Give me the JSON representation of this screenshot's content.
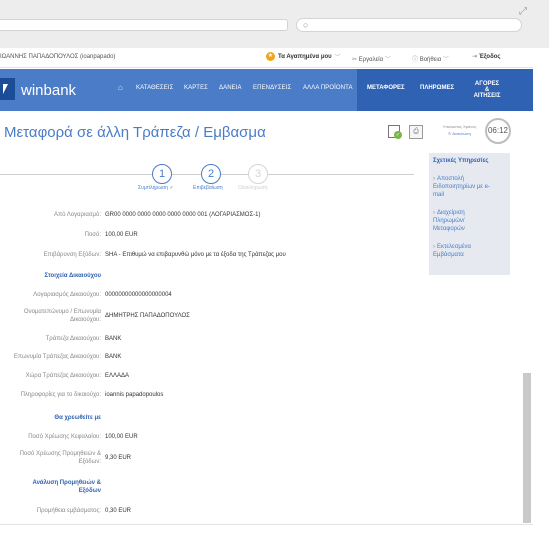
{
  "browser": {
    "search_icon": "search-icon",
    "expand_icon": "expand-icon"
  },
  "userbar": {
    "user": "ΙΩΑΝΝΗΣ ΠΑΠΑΔΟΠΟΥΛΟΣ (ioanpapado)",
    "favorites": "Τα Αγαπημένα μου",
    "tools": "Εργαλεία",
    "help": "Βοήθεια",
    "exit": "Έξοδος"
  },
  "nav": {
    "logo": "winbank",
    "items": [
      "ΚΑΤΑΘΕΣΕΙΣ",
      "ΚΑΡΤΕΣ",
      "ΔΑΝΕΙΑ",
      "ΕΠΕΝΔΥΣΕΙΣ",
      "ΑΛΛΑ ΠΡΟΪΟΝΤΑ"
    ],
    "right_items": [
      "ΜΕΤΑΦΟΡΕΣ",
      "ΠΛΗΡΩΜΕΣ",
      "ΑΓΟΡΕΣ",
      "& ΑΙΤΗΣΕΙΣ"
    ],
    "accent": "#4a7cc7",
    "active": "#2f62b3"
  },
  "page": {
    "title": "Μεταφορά σε άλλη Τράπεζα / Εμβασμα"
  },
  "steps": [
    {
      "num": "1",
      "label": "Συμπλήρωση ✓"
    },
    {
      "num": "2",
      "label": "Επιβεβαίωση"
    },
    {
      "num": "3",
      "label": "Ολοκλήρωση"
    }
  ],
  "form": {
    "from_account_label": "Από Λογαριασμό:",
    "from_account_value": "GR00 0000 0000 0000 0000 0000 001 (ΛΟΓΑΡΙΑΣΜΟΣ-1)",
    "amount_label": "Ποσό:",
    "amount_value": "100,00 EUR",
    "charges_label": "Επιβάρυνση Εξόδων:",
    "charges_value": "SHA - Επιθυμώ να επιβαρυνθώ μόνο με τα έξοδα της Τράπεζας μου",
    "beneficiary_section": "Στοιχεία Δικαιούχου",
    "ben_account_label": "Λογαριασμός Δικαιούχου:",
    "ben_account_value": "00000000000000000004",
    "ben_name_label_1": "Ονοματεπώνυμο / Επωνυμία",
    "ben_name_label_2": "Δικαιούχου:",
    "ben_name_value": "ΔΗΜΗΤΡΗΣ ΠΑΠΑΔΟΠΟΥΛΟΣ",
    "ben_bank_label": "Τράπεζα Δικαιούχου:",
    "ben_bank_value": "BANK",
    "ben_bank_name_label": "Επωνυμία Τράπεζας Δικαιούχου:",
    "ben_bank_name_value": "BANK",
    "ben_country_label": "Χώρα Τράπεζας Δικαιούχου:",
    "ben_country_value": "ΕΛΛΑΔΑ",
    "ben_info_label": "Πληροφορίες για το δικαιούχο:",
    "ben_info_value": "ioannis papadopoulos",
    "debit_section": "Θα χρεωθείτε με",
    "debit_principal_label": "Ποσό Χρέωσης Κεφαλαίου:",
    "debit_principal_value": "100,00 EUR",
    "debit_fees_label_1": "Ποσό Χρέωσης Προμηθειών &",
    "debit_fees_label_2": "Εξόδων:",
    "debit_fees_value": "9,30 EUR",
    "analysis_section_1": "Ανάλυση Προμηθειών &",
    "analysis_section_2": "Εξόδων",
    "remit_fee_label": "Προμήθεια εμβάσματος:",
    "remit_fee_value": "0,30 EUR"
  },
  "sidebar": {
    "clock_label": "Υπολοιπος Χρόνος",
    "clock_renew": "Ανανέωση",
    "clock_time": "06:12",
    "related_title": "Σχετικές Υπηρεσίες",
    "related_items": [
      [
        "Αποστολή",
        "Ειδοποιητηρίων με e-",
        "mail"
      ],
      [
        "Διαχείριση",
        "Πληρωμών/",
        "Μεταφορών"
      ],
      [
        "Εκτελεσμένα",
        "Εμβάσματα"
      ]
    ]
  }
}
